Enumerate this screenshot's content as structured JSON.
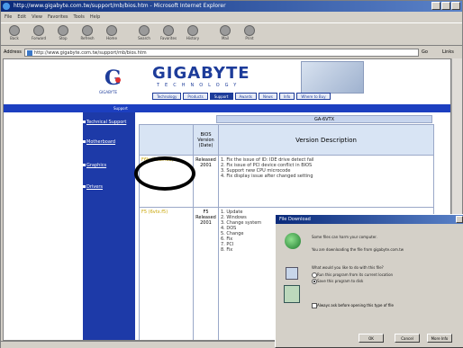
{
  "window": {
    "title": "http://www.gigabyte.com.tw/support/mb/bios.htm - Microsoft Internet Explorer"
  },
  "menubar": [
    "File",
    "Edit",
    "View",
    "Favorites",
    "Tools",
    "Help"
  ],
  "toolbar": [
    "Back",
    "Forward",
    "Stop",
    "Refresh",
    "Home",
    "Search",
    "Favorites",
    "History",
    "Mail",
    "Print"
  ],
  "address": {
    "label": "Address",
    "url": "http://www.gigabyte.com.tw/support/mb/bios.htm",
    "go": "Go",
    "links": "Links"
  },
  "banner": {
    "logo_sub": "GIGABYTE",
    "brand": "GIGABYTE",
    "brand_sub": "TECHNOLOGY",
    "nav": [
      "Technology",
      "Products",
      "Support",
      "Awards",
      "News",
      "Info",
      "Where to Buy"
    ]
  },
  "bluebar": "Support",
  "sidebar": [
    "Technical Support",
    "Motherboard",
    "Graphics",
    "Drivers"
  ],
  "table": {
    "caption": "GA-6VTX",
    "col_bios": "BIOS Version (Date)",
    "col_desc": "Version Description",
    "rows": [
      {
        "file": "F6b (6vtx.f6b)",
        "date": "Released 2001",
        "desc": [
          "1. Fix the issue of ID: IDE drive detect fail",
          "2. Fix issue of PCI device conflict in BIOS",
          "3. Support new CPU microcode",
          "4. Fix display issue after changed setting"
        ]
      },
      {
        "file": "F5 (6vtx.f5)",
        "date": "F5 Released 2001",
        "desc": [
          "1. Update",
          "2. Windows",
          "3. Change system",
          "4. DOS",
          "5. Change",
          "6. Fix",
          "7. PCI",
          "8. Fix"
        ]
      }
    ]
  },
  "dialog": {
    "title": "File Download",
    "text1": "Some files can harm your computer.",
    "text2": "You are downloading the file from gigabyte.com.tw",
    "question": "What would you like to do with this file?",
    "opt_open": "Run this program from its current location",
    "opt_save": "Save this program to disk",
    "checkbox": "Always ask before opening this type of file",
    "ok": "OK",
    "cancel": "Cancel",
    "more_info": "More Info"
  }
}
